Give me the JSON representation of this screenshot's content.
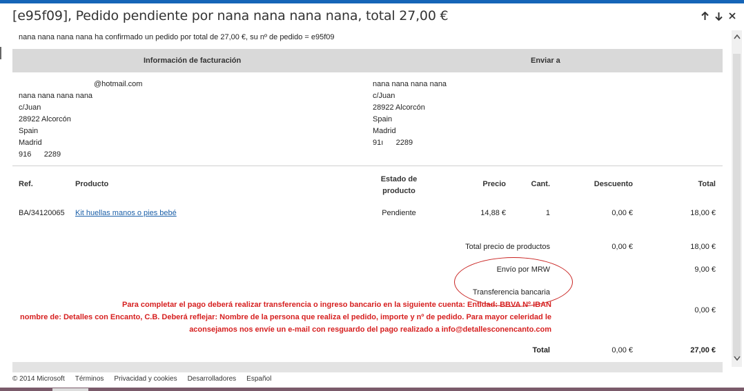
{
  "window": {
    "title": "[e95f09], Pedido pendiente por nana nana nana nana, total 27,00 €"
  },
  "colors": {
    "accent": "#1565b8",
    "warning_text": "#d61f1f",
    "header_band": "#d9d9d9",
    "link": "#1a5fa8"
  },
  "icons": {
    "up": "arrow-up-icon",
    "down": "arrow-down-icon",
    "close": "close-icon"
  },
  "email": {
    "confirmation": "nana nana nana nana ha confirmado un pedido por total de 27,00 €, su nº de pedido = e95f09",
    "billing_header": "Información de facturación",
    "shipping_header": "Enviar a",
    "billing": {
      "email": "@hotmail.com",
      "name": "nana nana nana nana",
      "street": "c/Juan",
      "city": "28922 Alcorcón",
      "country": "Spain",
      "region": "Madrid",
      "phone": "916      2289"
    },
    "shipping": {
      "name": "nana nana nana nana",
      "street": "c/Juan",
      "city": "28922 Alcorcón",
      "country": "Spain",
      "region": "Madrid",
      "phone": "91ı      2289"
    },
    "columns": {
      "ref": "Ref.",
      "product": "Producto",
      "status_line1": "Estado de",
      "status_line2": "producto",
      "price": "Precio",
      "qty": "Cant.",
      "discount": "Descuento",
      "total": "Total"
    },
    "item": {
      "ref": "BA/34120065",
      "product": "Kit huellas manos o pies bebé",
      "status": "Pendiente",
      "price": "14,88 €",
      "qty": "1",
      "discount": "0,00 €",
      "total": "18,00 €"
    },
    "summary": {
      "products_label": "Total precio de productos",
      "products_discount": "0,00 €",
      "products_total": "18,00 €",
      "shipping_label": "Envío por MRW",
      "shipping_total": "9,00 €",
      "payment_label": "Transferencia bancaria",
      "payment_total": "0,00 €",
      "total_label": "Total",
      "total_discount": "0,00 €",
      "grand_total": "27,00 €"
    },
    "payment_note": {
      "line1": "Para completar el pago deberá realizar transferencia o ingreso bancario en la siguiente cuenta: Entidad: BBVA Nº IBAN",
      "line2": "nombre de: Detalles con Encanto, C.B. Deberá reflejar: Nombre de la persona que realiza el pedido, importe y nº de pedido. Para mayor celeridad le",
      "line3": "aconsejamos nos envíe un e-mail con resguardo del pago realizado a info@detallesconencanto.com"
    }
  },
  "footer": {
    "copyright": "© 2014 Microsoft",
    "terms": "Términos",
    "privacy": "Privacidad y cookies",
    "developers": "Desarrolladores",
    "language": "Español"
  }
}
